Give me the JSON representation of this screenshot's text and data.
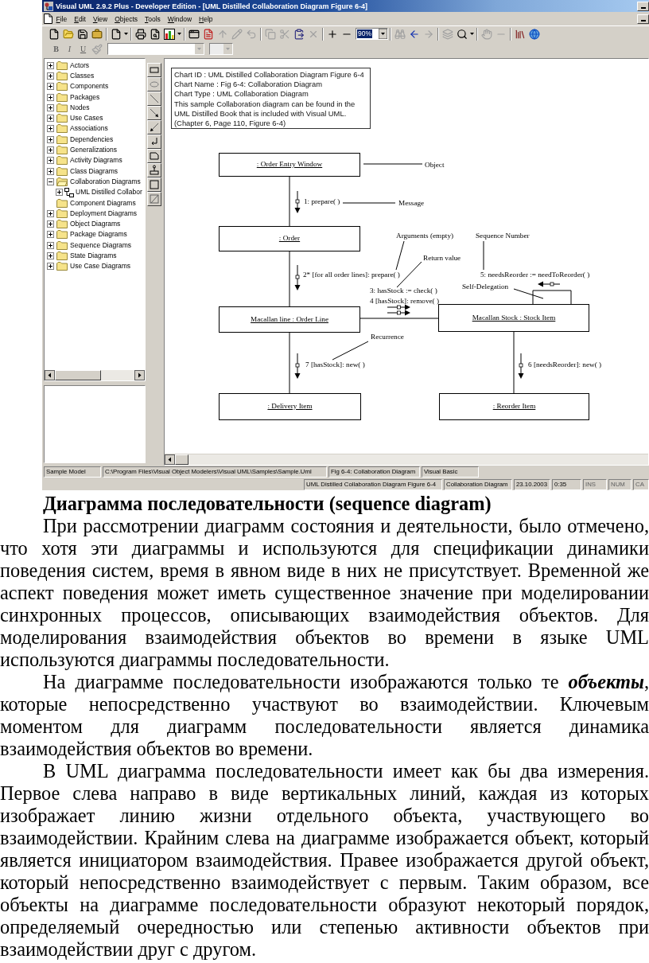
{
  "window": {
    "title": "Visual UML 2.9.2 Plus - Developer Edition - [UML Distilled Collaboration Diagram Figure 6-4]"
  },
  "menu": [
    {
      "label": "File"
    },
    {
      "label": "Edit"
    },
    {
      "label": "View"
    },
    {
      "label": "Objects"
    },
    {
      "label": "Tools"
    },
    {
      "label": "Window"
    },
    {
      "label": "Help"
    }
  ],
  "toolbar": {
    "zoom": "90%"
  },
  "format_bar": {
    "buttons": [
      {
        "label": "B",
        "disabled": true
      },
      {
        "label": "I",
        "disabled": true
      },
      {
        "label": "U",
        "disabled": true
      }
    ]
  },
  "tree": {
    "items": [
      {
        "label": "Actors",
        "kind": "folder",
        "has_children": true,
        "expanded": false
      },
      {
        "label": "Classes",
        "kind": "folder",
        "has_children": true,
        "expanded": false
      },
      {
        "label": "Components",
        "kind": "folder",
        "has_children": true,
        "expanded": false
      },
      {
        "label": "Packages",
        "kind": "folder",
        "has_children": true,
        "expanded": false
      },
      {
        "label": "Nodes",
        "kind": "folder",
        "has_children": true,
        "expanded": false
      },
      {
        "label": "Use Cases",
        "kind": "folder",
        "has_children": true,
        "expanded": false
      },
      {
        "label": "Associations",
        "kind": "folder",
        "has_children": true,
        "expanded": false
      },
      {
        "label": "Dependencies",
        "kind": "folder",
        "has_children": true,
        "expanded": false
      },
      {
        "label": "Generalizations",
        "kind": "folder",
        "has_children": true,
        "expanded": false
      },
      {
        "label": "Activity Diagrams",
        "kind": "folder",
        "has_children": true,
        "expanded": false
      },
      {
        "label": "Class Diagrams",
        "kind": "folder",
        "has_children": true,
        "expanded": false
      },
      {
        "label": "Collaboration Diagrams",
        "kind": "folder",
        "has_children": true,
        "expanded": true,
        "children": [
          {
            "label": "UML Distilled Collabor",
            "kind": "diagram",
            "has_children": true,
            "expanded": false
          }
        ]
      },
      {
        "label": "Component Diagrams",
        "kind": "folder",
        "has_children": false,
        "expanded": false
      },
      {
        "label": "Deployment Diagrams",
        "kind": "folder",
        "has_children": true,
        "expanded": false
      },
      {
        "label": "Object Diagrams",
        "kind": "folder",
        "has_children": true,
        "expanded": false
      },
      {
        "label": "Package Diagrams",
        "kind": "folder",
        "has_children": true,
        "expanded": false
      },
      {
        "label": "Sequence Diagrams",
        "kind": "folder",
        "has_children": true,
        "expanded": false
      },
      {
        "label": "State Diagrams",
        "kind": "folder",
        "has_children": true,
        "expanded": false
      },
      {
        "label": "Use Case Diagrams",
        "kind": "folder",
        "has_children": true,
        "expanded": false
      }
    ]
  },
  "diagram": {
    "info": {
      "lines": [
        "Chart ID : UML Distilled Collaboration Diagram Figure 6-4",
        "Chart Name : Fig 6-4: Collaboration Diagram",
        "Chart Type : UML Collaboration Diagram"
      ],
      "description": "This sample Collaboration diagram can be found in the UML Distilled Book that is included with Visual UML. (Chapter 6, Page 110, Figure 6-4)"
    },
    "objects": [
      {
        "label": ": Order Entry Window"
      },
      {
        "label": ": Order"
      },
      {
        "label": "Macallan line : Order Line"
      },
      {
        "label": "Macallan Stock : Stock Item"
      },
      {
        "label": ": Delivery Item"
      },
      {
        "label": ": Reorder Item"
      }
    ],
    "messages": [
      {
        "label": "1: prepare( )"
      },
      {
        "label": "2* [for all order lines]: prepare( )"
      },
      {
        "label": "3: hasStock := check( )"
      },
      {
        "label": "4 [hasStock]: remove( )"
      },
      {
        "label": "5: needsReorder := needToReorder( )"
      },
      {
        "label": "7 [hasStock]: new( )"
      },
      {
        "label": "6 [needsReorder]: new( )"
      }
    ],
    "notes": [
      {
        "label": "Object"
      },
      {
        "label": "Message"
      },
      {
        "label": "Arguments (empty)"
      },
      {
        "label": "Return value"
      },
      {
        "label": "Sequence Number"
      },
      {
        "label": "Self-Delegation"
      },
      {
        "label": "Recurrence"
      }
    ]
  },
  "status_bar": {
    "row_1": [
      {
        "text": "Sample Model"
      },
      {
        "text": "C:\\Program Files\\Visual Object Modelers\\Visual UML\\Samples\\Sample.Uml"
      },
      {
        "text": "Fig 6-4: Collaboration Diagram"
      },
      {
        "text": "Visual Basic"
      }
    ],
    "row_2": [
      {
        "text": "UML Distilled Collaboration Diagram Figure 6-4",
        "disabled": false
      },
      {
        "text": "Collaboration Diagram",
        "disabled": false
      },
      {
        "text": "23.10.2003",
        "disabled": false
      },
      {
        "text": "0:35",
        "disabled": false
      },
      {
        "text": "INS",
        "disabled": true
      },
      {
        "text": "NUM",
        "disabled": true
      },
      {
        "text": "CA",
        "disabled": true
      }
    ]
  },
  "article": {
    "heading": "Диаграмма последовательности (sequence diagram)",
    "paragraphs": [
      "При рассмотрении диаграмм состояния и деятельности, было отмечено, что хотя эти диаграммы и используются для спецификации динамики поведения систем, время в явном виде в них не присутствует. Временной же аспект поведения может иметь существенное значение при моделировании синхронных процессов, описывающих взаимодействия объектов. Для моделирования взаимодействия объектов во времени в языке UML используются диаграммы последовательности.",
      "На диаграмме последовательности изображаются только те **объекты**, которые непосредственно участвуют во взаимодействии. Ключевым моментом для диаграмм последовательности является динамика взаимодействия объектов во времени.",
      "В UML диаграмма последовательности имеет как бы два измерения. Первое слева направо в виде вертикальных линий, каждая из которых изображает линию жизни отдельного объекта, участвующего во взаимодействии. Крайним слева на диаграмме изображается объект, который является инициатором взаимодействия. Правее изображается другой объект, который непосредственно взаимодействует с первым. Таким образом, все объекты на диаграмме последовательности образуют некоторый порядок, определяемый очередностью или степенью активности объектов при взаимодействии друг с другом."
    ]
  }
}
